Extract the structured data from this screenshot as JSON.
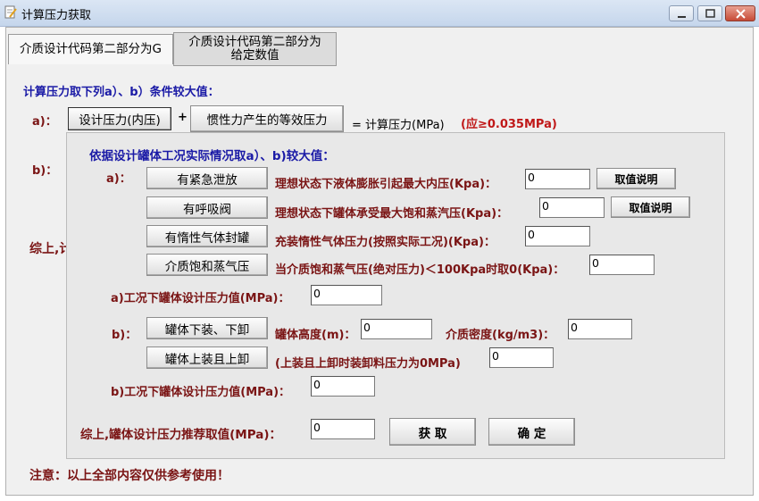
{
  "window": {
    "title": "计算压力获取"
  },
  "tabs": [
    {
      "label": "介质设计代码第二部分为G"
    },
    {
      "label_line1": "介质设计代码第二部分为",
      "label_line2": "给定数值"
    }
  ],
  "main": {
    "heading": "计算压力取下列a）、b）条件较大值：",
    "a_label": "a)：",
    "design_pressure_btn": "设计压力(内压)",
    "plus": "+",
    "inertia_btn": "惯性力产生的等效压力",
    "equals_text": "= 计算压力(MPa)",
    "min_note": "(应≥0.035MPa)",
    "b_label": "b)：",
    "summary_partial": "综上,计",
    "note": "注意：以上全部内容仅供参考使用！"
  },
  "panel": {
    "heading": "依据设计罐体工况实际情况取a）、b)较大值：",
    "a_label": "a)：",
    "rows_a": [
      {
        "button": "有紧急泄放",
        "desc": "理想状态下液体膨胀引起最大内压(Kpa)：",
        "value": "0",
        "help": "取值说明"
      },
      {
        "button": "有呼吸阀",
        "desc": "理想状态下罐体承受最大饱和蒸汽压(Kpa)：",
        "value": "0",
        "help": "取值说明"
      },
      {
        "button": "有惰性气体封罐",
        "desc": "充装惰性气体压力(按照实际工况)(Kpa)：",
        "value": "0"
      },
      {
        "button": "介质饱和蒸气压",
        "desc": "当介质饱和蒸气压(绝对压力)＜100Kpa时取0(Kpa)：",
        "value": "0"
      }
    ],
    "a_result_label": "a)工况下罐体设计压力值(MPa)：",
    "a_result_value": "0",
    "b_label": "b)：",
    "b_row1": {
      "button": "罐体下装、下卸",
      "height_label": "罐体高度(m)：",
      "height_value": "0",
      "density_label": "介质密度(kg/m3)：",
      "density_value": "0"
    },
    "b_row2": {
      "button": "罐体上装且上卸",
      "desc": "(上装且上卸时装卸料压力为0MPa)",
      "value": "0"
    },
    "b_result_label": "b)工况下罐体设计压力值(MPa)：",
    "b_result_value": "0",
    "final_label": "综上,罐体设计压力推荐取值(MPa)：",
    "final_value": "0",
    "get_btn": "获 取",
    "ok_btn": "确 定"
  }
}
